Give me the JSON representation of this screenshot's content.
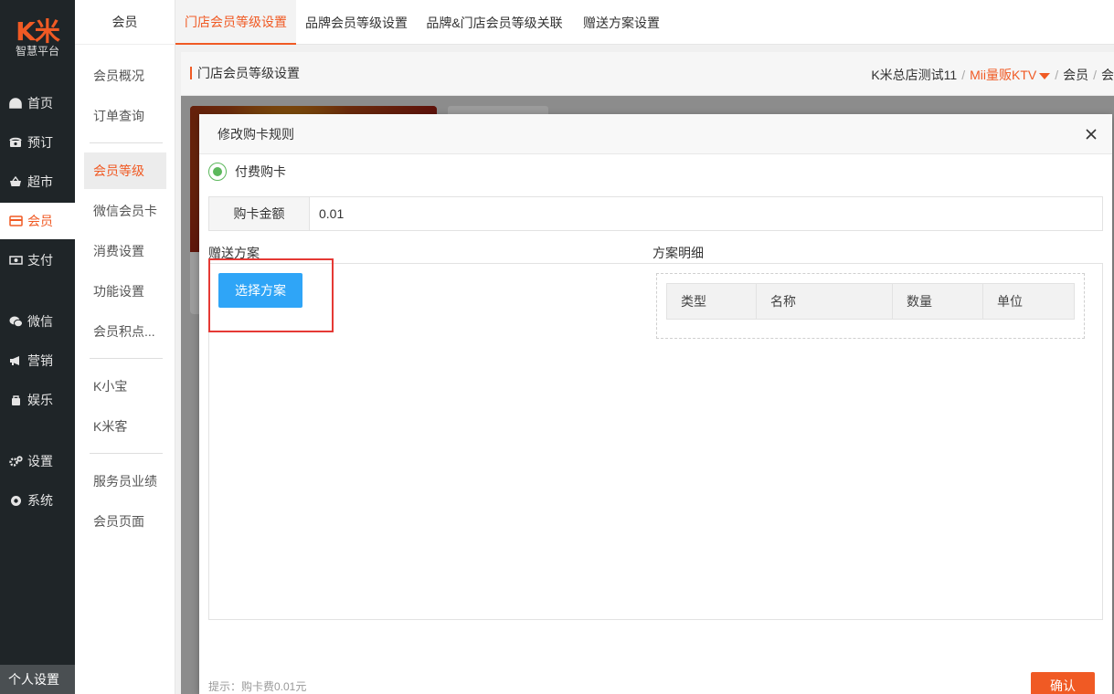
{
  "app": {
    "logo_text": "K米",
    "logo_sub": "智慧平台"
  },
  "nav": {
    "items": [
      {
        "label": "首页",
        "icon": "dashboard-icon"
      },
      {
        "label": "预订",
        "icon": "phone-icon"
      },
      {
        "label": "超市",
        "icon": "basket-icon"
      },
      {
        "label": "会员",
        "icon": "card-icon"
      },
      {
        "label": "支付",
        "icon": "money-icon"
      },
      {
        "label": "微信",
        "icon": "wechat-icon"
      },
      {
        "label": "营销",
        "icon": "megaphone-icon"
      },
      {
        "label": "娱乐",
        "icon": "game-icon"
      },
      {
        "label": "设置",
        "icon": "gear-icon"
      },
      {
        "label": "系统",
        "icon": "chrome-icon"
      }
    ],
    "active": "会员",
    "personal": "个人设置"
  },
  "side": {
    "title": "会员",
    "items": [
      "会员概况",
      "订单查询",
      "会员等级",
      "微信会员卡",
      "消费设置",
      "功能设置",
      "会员积点...",
      "K小宝",
      "K米客",
      "服务员业绩",
      "会员页面"
    ],
    "active": "会员等级"
  },
  "tabs": [
    "门店会员等级设置",
    "品牌会员等级设置",
    "品牌&门店会员等级关联",
    "赠送方案设置"
  ],
  "breadcrumb": {
    "title": "门店会员等级设置",
    "store_group": "K米总店测试11",
    "store": "Mii量贩KTV",
    "section": "会员",
    "truncated": "会"
  },
  "modal": {
    "title": "修改购卡规则",
    "radio_label": "付费购卡",
    "amount_label": "购卡金额",
    "amount_value": "0.01",
    "gift_label": "赠送方案",
    "detail_label": "方案明细",
    "select_button": "选择方案",
    "columns": [
      "类型",
      "名称",
      "数量",
      "单位"
    ],
    "hint": "提示：购卡费0.01元",
    "confirm": "确认"
  },
  "colors": {
    "accent": "#f05a24",
    "nav_bg": "#1f2528",
    "primary_button": "#2fa5f7",
    "highlight": "#e53935",
    "radio": "#5cb85c"
  }
}
